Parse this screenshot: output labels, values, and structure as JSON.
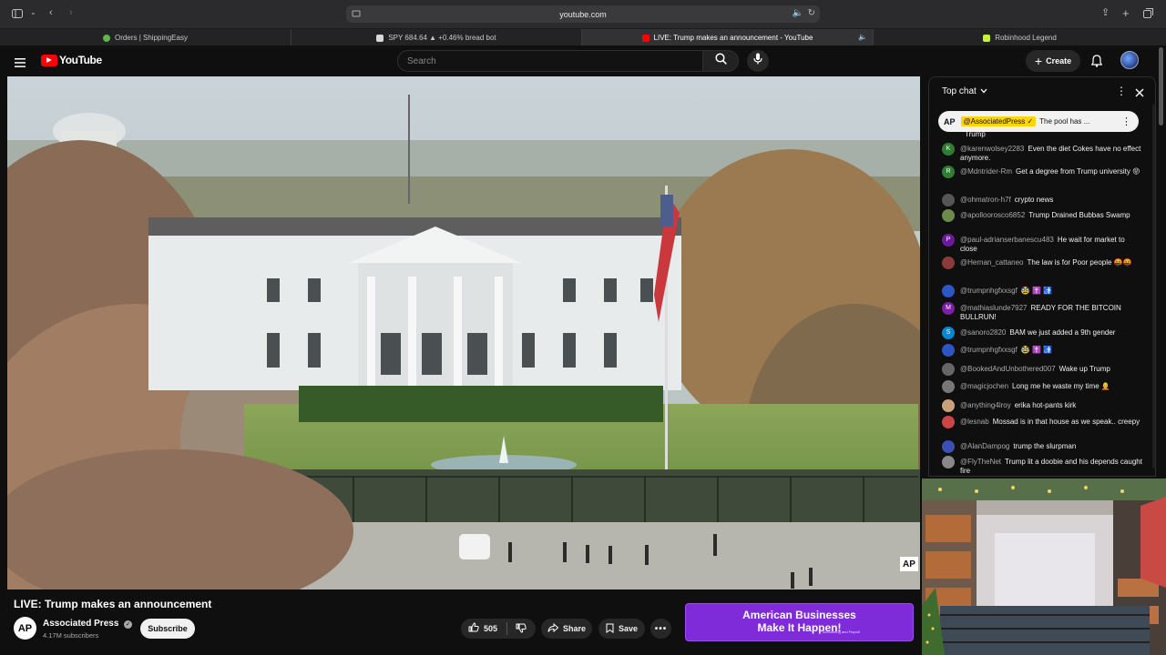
{
  "browser": {
    "url": "youtube.com",
    "tabs": [
      {
        "label": "Orders | ShippingEasy",
        "color": "#5fb54a"
      },
      {
        "label": "SPY 684.64 ▲ +0.46% bread bot",
        "color": "#d8d8d8"
      },
      {
        "label": "LIVE: Trump makes an announcement - YouTube",
        "color": "#ff0000"
      },
      {
        "label": "Robinhood Legend",
        "color": "#c5f23a"
      }
    ]
  },
  "header": {
    "logo_text": "YouTube",
    "search_placeholder": "Search",
    "create_label": "Create"
  },
  "video": {
    "title": "LIVE: Trump makes an announcement",
    "channel": "Associated Press",
    "subscribers": "4.17M subscribers",
    "subscribe_label": "Subscribe",
    "likes": "505",
    "share_label": "Share",
    "save_label": "Save",
    "watermark": "AP"
  },
  "chat": {
    "header_label": "Top chat",
    "pinned": {
      "author": "@AssociatedPress",
      "text": "The pool has ..."
    },
    "partial_text": "Trump",
    "messages": [
      {
        "author": "@karenwolsey2283",
        "text": "Even the diet Cokes have no effect anymore.",
        "initial": "K",
        "color": "#2e7d32"
      },
      {
        "author": "@Mdntrider-Rm",
        "text": "Get a degree from Trump university 😝",
        "initial": "R",
        "color": "#2e7d32"
      },
      {
        "author": "@ohmatron-h7f",
        "text": "crypto news",
        "initial": "",
        "color": "#555"
      },
      {
        "author": "@apolloorosco6852",
        "text": "Trump Drained Bubbas Swamp",
        "initial": "",
        "color": "#6d8a4d"
      },
      {
        "author": "@paul-adrianserbanescu483",
        "text": "He wait for market to close",
        "initial": "P",
        "color": "#6a1b9a"
      },
      {
        "author": "@Hernan_cattaneo",
        "text": "The law is for Poor people 🤬🤬",
        "initial": "",
        "color": "#8b3a3a"
      },
      {
        "author": "@trumpnhgfxxsgf",
        "text": "🥸 ✝️ 🚮",
        "initial": "",
        "color": "#2d55c4"
      },
      {
        "author": "@mathiaslunde7927",
        "text": "READY FOR THE BITCOIN BULLRUN!",
        "initial": "M",
        "color": "#7b1fa2"
      },
      {
        "author": "@sanoro2820",
        "text": "BAM we just added a 9th gender",
        "initial": "S",
        "color": "#0288d1"
      },
      {
        "author": "@trumpnhgfxxsgf",
        "text": "🥸 ✝️ 🚮",
        "initial": "",
        "color": "#2d55c4"
      },
      {
        "author": "@BookedAndUnbothered007",
        "text": "Wake up Trump",
        "initial": "",
        "color": "#666"
      },
      {
        "author": "@magicjochen",
        "text": "Long me he waste my time 🧑‍🦲",
        "initial": "",
        "color": "#777"
      },
      {
        "author": "@anything4lroy",
        "text": "erika hot-pants kirk",
        "initial": "",
        "color": "#c9a27a"
      },
      {
        "author": "@lesnab",
        "text": "Mossad is in that house as we speak.. creepy",
        "initial": "",
        "color": "#c44"
      },
      {
        "author": "@AlanDampog",
        "text": "trump the slurpman",
        "initial": "",
        "color": "#3b4fb4"
      },
      {
        "author": "@FlyTheNet",
        "text": "Trump lit a doobie and his depends caught fire",
        "initial": "",
        "color": "#888"
      }
    ]
  },
  "ad": {
    "line1": "American Businesses",
    "line2": "Make It Happen!",
    "small": "Accounting and Payroll"
  },
  "colors": {
    "youtube_red": "#ff0000",
    "ad_purple": "#7f2bd9"
  }
}
